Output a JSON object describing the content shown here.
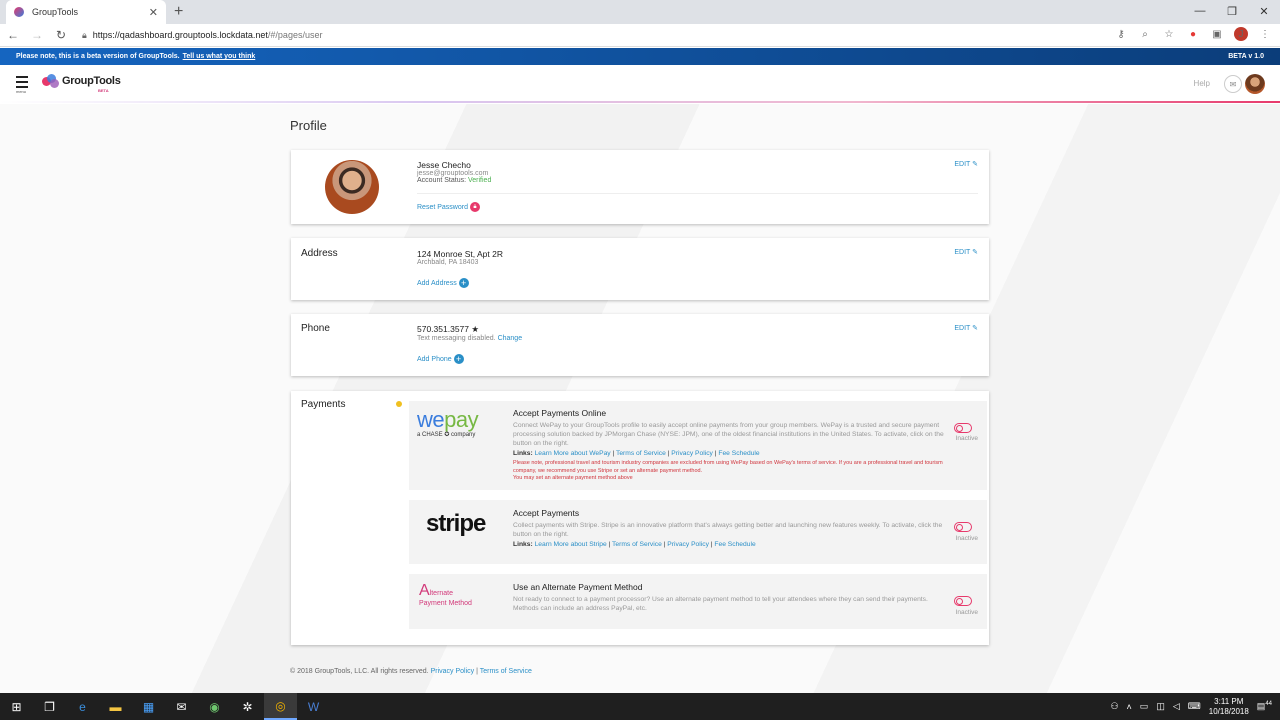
{
  "browser": {
    "tab_title": "GroupTools",
    "tab_close": "✕",
    "new_tab": "+",
    "url_host": "https://qadashboard.grouptools.lockdata.net",
    "url_path": "/#/pages/user",
    "win_min": "—",
    "win_max": "❐",
    "win_close": "✕",
    "profile_initial": "J"
  },
  "beta_bar": {
    "notice": "Please note, this is a beta version of GroupTools.",
    "link": "Tell us what you think",
    "version": "BETA v 1.0"
  },
  "header": {
    "menu_label": "menu",
    "logo_text": "GroupTools",
    "logo_beta": "BETA",
    "help": "Help"
  },
  "page": {
    "title": "Profile",
    "edit_label": "EDIT",
    "profile": {
      "name": "Jesse Checho",
      "email": "jesse@grouptools.com",
      "status_label": "Account Status:",
      "status_value": "Verified",
      "reset_password": "Reset Password"
    },
    "address": {
      "label": "Address",
      "line1": "124 Monroe St, Apt 2R",
      "line2": "Archbald, PA 18403",
      "add": "Add Address"
    },
    "phone": {
      "label": "Phone",
      "number": "570.351.3577",
      "star": "★",
      "sms_text": "Text messaging disabled.",
      "sms_change": "Change",
      "add": "Add Phone"
    },
    "payments": {
      "label": "Payments",
      "wepay": {
        "logo_we": "we",
        "logo_pay": "pay",
        "logo_sub": "a CHASE ✪ company",
        "title": "Accept Payments Online",
        "desc": "Connect WePay to your GroupTools profile to easily accept online payments from your group members. WePay is a trusted and secure payment processing solution backed by JPMorgan Chase (NYSE: JPM), one of the oldest financial institutions in the United States. To activate, click on the button on the right.",
        "links_label": "Links:",
        "link1": "Learn More about WePay",
        "link2": "Terms of Service",
        "link3": "Privacy Policy",
        "link4": "Fee Schedule",
        "warning1": "Please note, professional travel and tourism industry companies are excluded from using WePay based on WePay's terms of service. If you are a professional travel and tourism company, we recommend you use Stripe or set an alternate payment method.",
        "warning2": "You may set an alternate payment method above",
        "state": "Inactive"
      },
      "stripe": {
        "logo": "stripe",
        "title": "Accept Payments",
        "desc": "Collect payments with Stripe. Stripe is an innovative platform that's always getting better and launching new features weekly. To activate, click the button on the right.",
        "links_label": "Links:",
        "link1": "Learn More about Stripe",
        "link2": "Terms of Service",
        "link3": "Privacy Policy",
        "link4": "Fee Schedule",
        "state": "Inactive"
      },
      "alternate": {
        "logo_a": "A",
        "logo_line1": "lternate",
        "logo_line2": "Payment Method",
        "title": "Use an Alternate Payment Method",
        "desc": "Not ready to connect to a payment processor? Use an alternate payment method to tell your attendees where they can send their payments. Methods can include an address PayPal, etc.",
        "state": "Inactive"
      }
    },
    "footer": {
      "copyright": "© 2018 GroupTools, LLC. All rights reserved.",
      "privacy": "Privacy Policy",
      "terms": "Terms of Service"
    }
  },
  "taskbar": {
    "time": "3:11 PM",
    "date": "10/18/2018",
    "notif_count": "44"
  },
  "colors": {
    "accent_blue": "#2a8fc7",
    "accent_pink": "#e7396b",
    "verified_green": "#4caf50",
    "warning_red": "#d0343c"
  }
}
